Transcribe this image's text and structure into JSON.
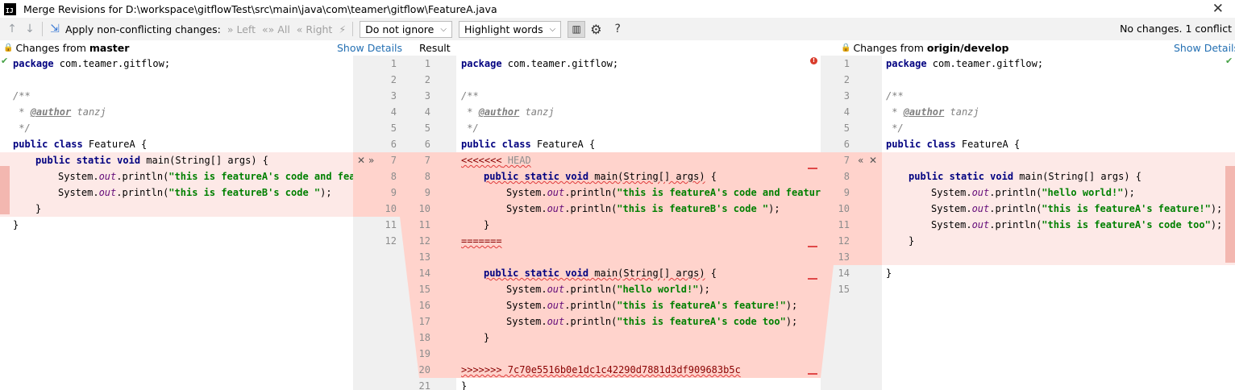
{
  "window": {
    "title": "Merge Revisions for D:\\workspace\\gitflowTest\\src\\main\\java\\com\\teamer\\gitflow\\FeatureA.java",
    "logo_text": "IJ"
  },
  "toolbar": {
    "apply_label": "Apply non-conflicting changes:",
    "left_label": "Left",
    "all_label": "All",
    "right_label": "Right",
    "ignore_value": "Do not ignore",
    "highlight_value": "Highlight words",
    "help_label": "?",
    "status": "No changes. 1 conflict"
  },
  "left_panel": {
    "header_prefix": "Changes from",
    "branch": "master",
    "show_details": "Show Details"
  },
  "middle_panel": {
    "header": "Result"
  },
  "right_panel": {
    "header_prefix": "Changes from",
    "branch": "origin/develop",
    "show_details": "Show Details"
  },
  "left_gutter_numbers": [
    "1",
    "2",
    "3",
    "4",
    "5",
    "6",
    "7",
    "8",
    "9",
    "10",
    "11",
    "12"
  ],
  "result_gutter_numbers": [
    "1",
    "2",
    "3",
    "4",
    "5",
    "6",
    "7",
    "8",
    "9",
    "10",
    "11",
    "12",
    "13",
    "14",
    "15",
    "16",
    "17",
    "18",
    "19",
    "20",
    "21"
  ],
  "right_gutter_numbers": [
    "1",
    "2",
    "3",
    "4",
    "5",
    "6",
    "7",
    "8",
    "9",
    "10",
    "11",
    "12",
    "13",
    "14",
    "15"
  ],
  "left_code": {
    "l1a": "package",
    "l1b": " com.teamer.gitflow;",
    "l3": "/**",
    "l4a": " * ",
    "l4b": "@author",
    "l4c": " tanzj",
    "l5": " */",
    "l6a": "public class",
    "l6b": " FeatureA {",
    "l7a": "public static void",
    "l7b": " main(String[] args) {",
    "l8a": "System.",
    "l8b": "out",
    "l8c": ".println(",
    "l8d": "\"this is featureA's code and feat",
    "l9a": "System.",
    "l9b": "out",
    "l9c": ".println(",
    "l9d": "\"this is featureB's code \"",
    "l9e": ");",
    "l10": "}",
    "l11": "}"
  },
  "result_code": {
    "r1a": "package",
    "r1b": " com.teamer.gitflow;",
    "r3": "/**",
    "r4a": " * ",
    "r4b": "@author",
    "r4c": " tanzj",
    "r5": " */",
    "r6a": "public class",
    "r6b": " FeatureA {",
    "r7a": "<<<<<<<",
    "r7b": " HEAD",
    "r8a": "public static void",
    "r8b": " main(String[] args)",
    "r8c": " {",
    "r9a": "System.",
    "r9b": "out",
    "r9c": ".println(",
    "r9d": "\"this is featureA's code and featureB",
    "r10a": "System.",
    "r10b": "out",
    "r10c": ".println(",
    "r10d": "\"this is featureB's code \"",
    "r10e": ");",
    "r11": "}",
    "r12": "=======",
    "r14a": "public static void",
    "r14b": " main(String[] args)",
    "r14c": " {",
    "r15a": "System.",
    "r15b": "out",
    "r15c": ".println(",
    "r15d": "\"hello world!\"",
    "r15e": ");",
    "r16a": "System.",
    "r16b": "out",
    "r16c": ".println(",
    "r16d": "\"this is featureA's feature!\"",
    "r16e": ");",
    "r17a": "System.",
    "r17b": "out",
    "r17c": ".println(",
    "r17d": "\"this is featureA's code too\"",
    "r17e": ");",
    "r18": "}",
    "r20a": ">>>>>>>",
    "r20b": " 7c70e5516b0e1dc1c42290d7881d3df909683b5c",
    "r21": "}"
  },
  "right_code": {
    "g1a": "package",
    "g1b": " com.teamer.gitflow;",
    "g3": "/**",
    "g4a": " * ",
    "g4b": "@author",
    "g4c": " tanzj",
    "g5": " */",
    "g6a": "public class",
    "g6b": " FeatureA {",
    "g8a": "public static void",
    "g8b": " main(String[] args) {",
    "g9a": "System.",
    "g9b": "out",
    "g9c": ".println(",
    "g9d": "\"hello world!\"",
    "g9e": ");",
    "g10a": "System.",
    "g10b": "out",
    "g10c": ".println(",
    "g10d": "\"this is featureA's feature!\"",
    "g10e": ");",
    "g11a": "System.",
    "g11b": "out",
    "g11c": ".println(",
    "g11d": "\"this is featureA's code too\"",
    "g11e": ");",
    "g12": "}",
    "g14": "}"
  },
  "colors": {
    "conflict_band": "#ffd3cc",
    "side_band": "#fde9e7",
    "gutter_bg": "#f0f0f0",
    "link": "#2470b3",
    "keyword": "#000080",
    "string": "#008000"
  }
}
